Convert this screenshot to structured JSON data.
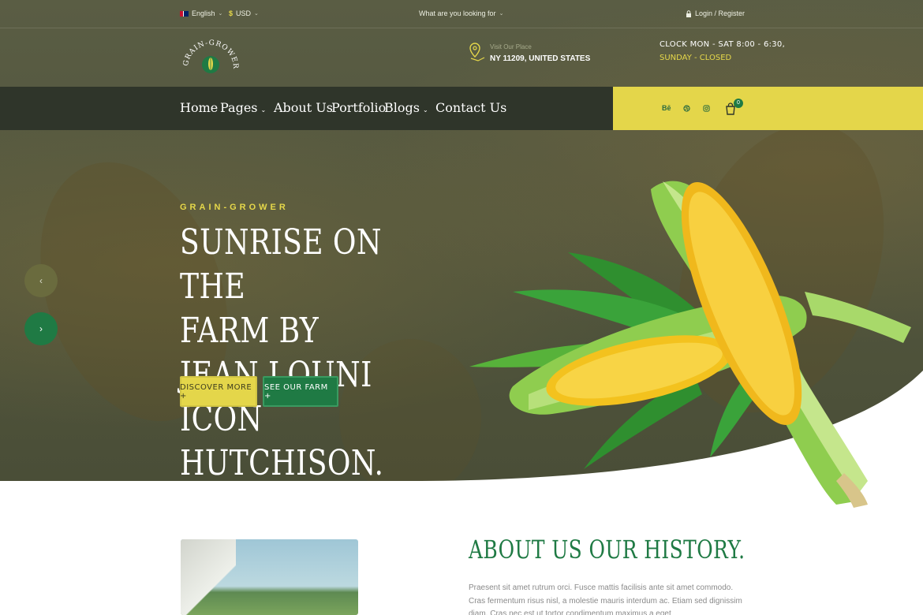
{
  "topbar": {
    "language": "English",
    "currency": "USD",
    "search_prompt": "What are you looking for",
    "login": "Login / Register"
  },
  "header": {
    "logo_text": "GRAIN-GROWER",
    "visit_label": "Visit Our Place",
    "visit_value": "NY 11209, UNITED STATES",
    "clock_line": "CLOCK  MON - SAT 8:00 - 6:30,",
    "closed_line": "SUNDAY - CLOSED"
  },
  "nav": {
    "items": [
      {
        "label": "Home",
        "dropdown": false
      },
      {
        "label": "Pages",
        "dropdown": true
      },
      {
        "label": "About Us",
        "dropdown": false
      },
      {
        "label": "Portfolio",
        "dropdown": false
      },
      {
        "label": "Blogs",
        "dropdown": true
      },
      {
        "label": "Contact Us",
        "dropdown": false
      }
    ],
    "social": [
      "Bē",
      "dribbble-icon",
      "instagram-icon"
    ],
    "cart_count": "0"
  },
  "hero": {
    "kicker": "GRAIN-GROWER",
    "title_line1": "SUNRISE ON THE",
    "title_line2": "FARM BY JEAN LOUNI",
    "title_line3": "ICON HUTCHISON.",
    "btn_discover": "DISCOVER MORE +",
    "btn_farm": "SEE OUR FARM +",
    "prev": "‹",
    "next": "›"
  },
  "about": {
    "title": "ABOUT US OUR HISTORY.",
    "text": "Praesent sit amet rutrum orci. Fusce mattis facilisis ante sit amet commodo. Cras fermentum risus nisl, a molestie mauris interdum ac. Etiam sed dignissim diam. Cras nec est ut tortor condimentum maximus a eget"
  },
  "colors": {
    "accent_yellow": "#e4d64a",
    "accent_green": "#1f7a44",
    "nav_dark": "#2f352a",
    "hero_olive": "#53573f"
  }
}
